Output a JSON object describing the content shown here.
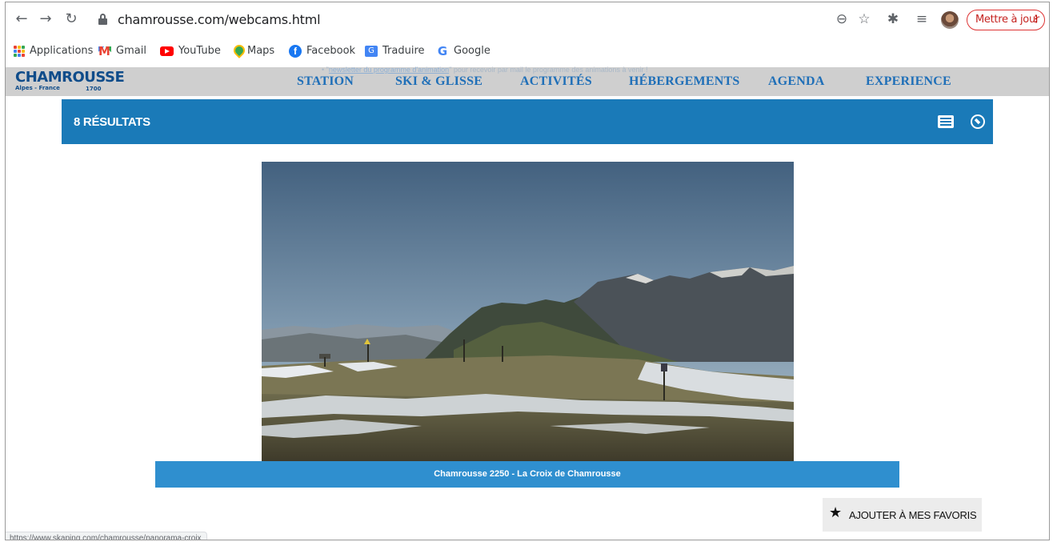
{
  "browser": {
    "url": "chamrousse.com/webcams.html",
    "update_label": "Mettre à jour"
  },
  "bookmarks": [
    {
      "label": "Applications",
      "icon": "apps-grid-icon"
    },
    {
      "label": "Gmail",
      "icon": "gmail-icon"
    },
    {
      "label": "YouTube",
      "icon": "youtube-icon"
    },
    {
      "label": "Maps",
      "icon": "maps-icon"
    },
    {
      "label": "Facebook",
      "icon": "facebook-icon"
    },
    {
      "label": "Traduire",
      "icon": "translate-icon"
    },
    {
      "label": "Google",
      "icon": "google-icon"
    }
  ],
  "site": {
    "logo": {
      "name": "CHAMROUSSE",
      "tagline": "Alpes - France",
      "altitude": "1700"
    },
    "newsletter": {
      "bullet": "• \"",
      "link": "newsletter du programme d'animation",
      "rest": "\" pour recevoir par mail le programme des animations à venir !"
    },
    "nav": [
      "STATION",
      "SKI & GLISSE",
      "ACTIVITÉS",
      "HÉBERGEMENTS",
      "AGENDA",
      "EXPERIENCE"
    ]
  },
  "results": {
    "title": "8 RÉSULTATS"
  },
  "webcam": {
    "caption": "Chamrousse 2250 - La Croix de Chamrousse"
  },
  "favorites": {
    "label": "AJOUTER À MES FAVORIS"
  },
  "status": {
    "hover_url": "https://www.skaping.com/chamrousse/panorama-croix"
  },
  "colors": {
    "accent": "#1a7ab8",
    "caption": "#2f8fcf",
    "nav_text": "#1f6fb8",
    "header_bg": "#cfcfcf"
  }
}
